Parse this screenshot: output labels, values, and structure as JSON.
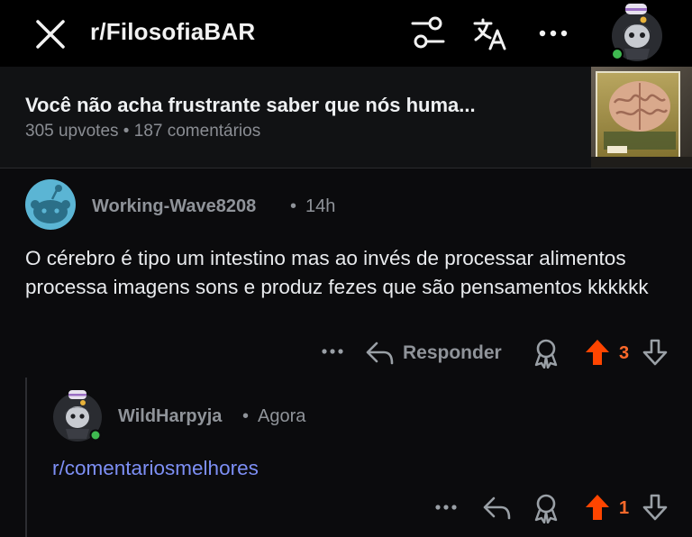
{
  "topbar": {
    "subreddit": "r/FilosofiaBAR",
    "close_icon": "close-icon",
    "filter_icon": "sort-filter-icon",
    "translate_icon": "translate-icon",
    "more_icon": "more-horizontal-icon"
  },
  "post": {
    "title": "Você não acha frustrante saber que nós huma...",
    "upvotes": "305 upvotes",
    "separator": " • ",
    "comments": "187 comentários"
  },
  "comment1": {
    "username": "Working-Wave8208",
    "separator": "•",
    "time": "14h",
    "body": "O cérebro é tipo um intestino mas ao invés de processar alimentos processa imagens sons e produz fezes que são pensamentos kkkkkk",
    "reply_label": "Responder",
    "vote_count": "3"
  },
  "comment2": {
    "username": "WildHarpyja",
    "separator": "•",
    "time": "Agora",
    "body_link": "r/comentariosmelhores",
    "vote_count": "1"
  },
  "colors": {
    "background": "#0b0b0d",
    "upvote": "#ff4500",
    "link": "#7d8ff5",
    "online": "#3fb950"
  }
}
